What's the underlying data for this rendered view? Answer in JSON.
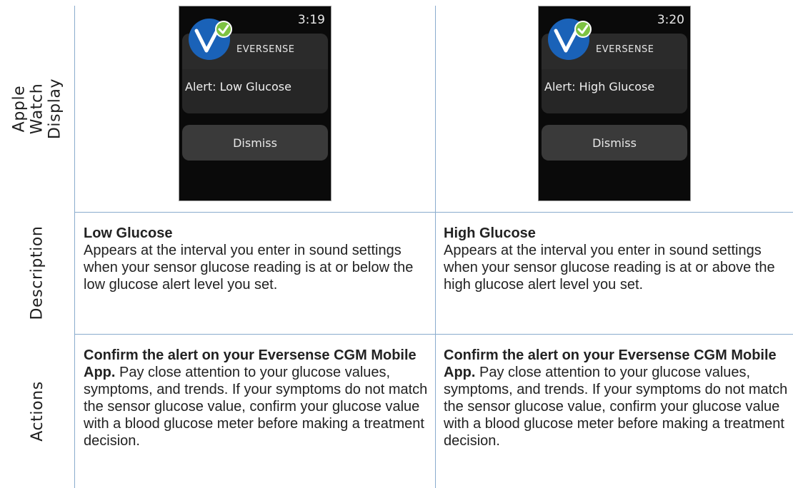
{
  "rows": {
    "watch_label": "Apple Watch Display",
    "description_label": "Description",
    "actions_label": "Actions"
  },
  "watch": {
    "app_name": "EVERSENSE",
    "dismiss_label": "Dismiss"
  },
  "low": {
    "time": "3:19",
    "alert_text": "Alert:  Low Glucose",
    "title": "Low Glucose",
    "description": "Appears at the interval you enter in sound settings when your sensor glucose reading is at or below the low glucose alert level you set.",
    "action_bold": "Confirm the alert on your Eversense CGM Mobile App.",
    "action_text": " Pay close attention to your glucose values, symptoms, and trends. If your symptoms do not match the sensor glucose value, confirm your glucose value with a blood glucose meter before making a treatment decision."
  },
  "high": {
    "time": "3:20",
    "alert_text": "Alert:  High Glucose",
    "title": "High Glucose",
    "description": "Appears at the interval you enter in sound settings when your sensor glucose reading is at or above the high glucose alert level you set.",
    "action_bold": "Confirm the alert on your Eversense CGM Mobile App.",
    "action_text": " Pay close attention to your glucose values, symptoms, and trends. If your symptoms do not match the sensor glucose value, confirm your glucose value with a blood glucose meter before making a treatment decision."
  },
  "colors": {
    "grid_line": "#8aaccd",
    "logo_blue": "#1a62b8",
    "logo_green": "#7dc242"
  }
}
